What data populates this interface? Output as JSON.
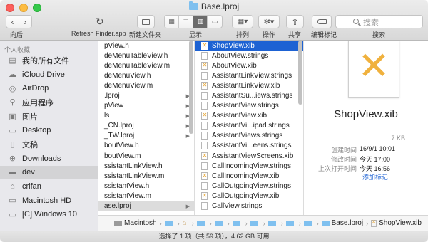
{
  "window": {
    "title": "Base.lproj"
  },
  "toolbar": {
    "back_label": "向后",
    "refresh_label": "Refresh Finder.app",
    "new_folder_label": "新建文件夹",
    "view_label": "显示",
    "arrange_label": "排列",
    "action_label": "操作",
    "share_label": "共享",
    "tags_label": "编辑标记",
    "search_label": "搜索",
    "search_placeholder": "搜索"
  },
  "sidebar": {
    "section_header": "个人收藏",
    "items": [
      {
        "label": "我的所有文件",
        "icon": "all-files-icon"
      },
      {
        "label": "iCloud Drive",
        "icon": "cloud-icon"
      },
      {
        "label": "AirDrop",
        "icon": "airdrop-icon"
      },
      {
        "label": "应用程序",
        "icon": "applications-icon"
      },
      {
        "label": "图片",
        "icon": "camera-icon"
      },
      {
        "label": "Desktop",
        "icon": "desktop-icon"
      },
      {
        "label": "文稿",
        "icon": "documents-icon"
      },
      {
        "label": "Downloads",
        "icon": "downloads-icon"
      },
      {
        "label": "dev",
        "icon": "folder-icon",
        "selected": true
      },
      {
        "label": "crifan",
        "icon": "home-icon"
      },
      {
        "label": "Macintosh HD",
        "icon": "hard-drive-icon"
      },
      {
        "label": "[C] Windows 10",
        "icon": "hard-drive-icon"
      }
    ]
  },
  "column1": {
    "items": [
      {
        "label": "pView.h",
        "arrow": false
      },
      {
        "label": "deMenuTableView.h",
        "arrow": false
      },
      {
        "label": "deMenuTableView.m",
        "arrow": false
      },
      {
        "label": "deMenuView.h",
        "arrow": false
      },
      {
        "label": "deMenuView.m",
        "arrow": false
      },
      {
        "label": ".lproj",
        "arrow": true
      },
      {
        "label": "pView",
        "arrow": true
      },
      {
        "label": "ls",
        "arrow": true
      },
      {
        "label": "_CN.lproj",
        "arrow": true
      },
      {
        "label": "_TW.lproj",
        "arrow": true
      },
      {
        "label": "boutView.h",
        "arrow": false
      },
      {
        "label": "boutView.m",
        "arrow": false
      },
      {
        "label": "ssistantLinkView.h",
        "arrow": false
      },
      {
        "label": "ssistantLinkView.m",
        "arrow": false
      },
      {
        "label": "ssistantView.h",
        "arrow": false
      },
      {
        "label": "ssistantView.m",
        "arrow": false
      },
      {
        "label": "ase.lproj",
        "arrow": true,
        "selected": true
      }
    ]
  },
  "column2": {
    "items": [
      {
        "label": "ShopView.xib",
        "type": "xib",
        "selected": true
      },
      {
        "label": "AboutView.strings",
        "type": "strings"
      },
      {
        "label": "AboutView.xib",
        "type": "xib"
      },
      {
        "label": "AssistantLinkView.strings",
        "type": "strings"
      },
      {
        "label": "AssistantLinkView.xib",
        "type": "xib"
      },
      {
        "label": "AssistantSu...iews.strings",
        "type": "strings"
      },
      {
        "label": "AssistantView.strings",
        "type": "strings"
      },
      {
        "label": "AssistantView.xib",
        "type": "xib"
      },
      {
        "label": "AssistantVi...ipad.strings",
        "type": "strings"
      },
      {
        "label": "AssistantViews.strings",
        "type": "strings"
      },
      {
        "label": "AssistantVi...eens.strings",
        "type": "strings"
      },
      {
        "label": "AssistantViewScreens.xib",
        "type": "xib"
      },
      {
        "label": "CallIncomingView.strings",
        "type": "strings"
      },
      {
        "label": "CallIncomingView.xib",
        "type": "xib"
      },
      {
        "label": "CallOutgoingView.strings",
        "type": "strings"
      },
      {
        "label": "CallOutgoingView.xib",
        "type": "xib"
      },
      {
        "label": "CallView.strings",
        "type": "strings"
      }
    ]
  },
  "preview": {
    "file_name": "ShopView.xib",
    "size": "7 KB",
    "created_label": "创建时间",
    "created_value": "16/9/1 10:01",
    "modified_label": "修改时间",
    "modified_value": "今天 17:00",
    "opened_label": "上次打开时间",
    "opened_value": "今天 16:56",
    "add_tags_link": "添加标记..."
  },
  "pathbar": {
    "items": [
      {
        "label": "Macintosh",
        "icon": "hard-drive-icon"
      },
      {
        "label": "",
        "icon": "folder-icon"
      },
      {
        "label": "",
        "icon": "home-icon"
      },
      {
        "label": "",
        "icon": "folder-icon"
      },
      {
        "label": "",
        "icon": "folder-icon"
      },
      {
        "label": "",
        "icon": "folder-icon"
      },
      {
        "label": "",
        "icon": "folder-icon"
      },
      {
        "label": "",
        "icon": "folder-icon"
      },
      {
        "label": "",
        "icon": "folder-icon"
      },
      {
        "label": "",
        "icon": "folder-icon"
      },
      {
        "label": "Base.lproj",
        "icon": "folder-icon"
      },
      {
        "label": "ShopView.xib",
        "icon": "xib-file-icon"
      }
    ]
  },
  "statusbar": {
    "text": "选择了 1 项（共 59 项），4.62 GB 可用"
  }
}
